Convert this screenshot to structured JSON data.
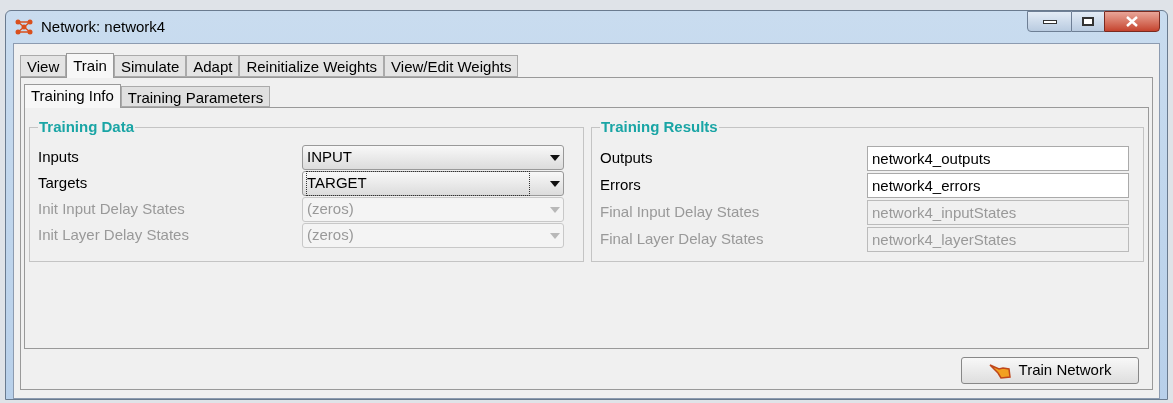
{
  "window": {
    "title": "Network: network4"
  },
  "tabs": [
    {
      "label": "View",
      "selected": false
    },
    {
      "label": "Train",
      "selected": true
    },
    {
      "label": "Simulate",
      "selected": false
    },
    {
      "label": "Adapt",
      "selected": false
    },
    {
      "label": "Reinitialize Weights",
      "selected": false
    },
    {
      "label": "View/Edit Weights",
      "selected": false
    }
  ],
  "subtabs": [
    {
      "label": "Training Info",
      "selected": true
    },
    {
      "label": "Training Parameters",
      "selected": false
    }
  ],
  "training_data": {
    "title": "Training Data",
    "rows": [
      {
        "label": "Inputs",
        "value": "INPUT",
        "disabled": false,
        "focused": false
      },
      {
        "label": "Targets",
        "value": "TARGET",
        "disabled": false,
        "focused": true
      },
      {
        "label": "Init Input Delay States",
        "value": "(zeros)",
        "disabled": true,
        "focused": false
      },
      {
        "label": "Init Layer Delay States",
        "value": "(zeros)",
        "disabled": true,
        "focused": false
      }
    ]
  },
  "training_results": {
    "title": "Training Results",
    "rows": [
      {
        "label": "Outputs",
        "value": "network4_outputs",
        "disabled": false
      },
      {
        "label": "Errors",
        "value": "network4_errors",
        "disabled": false
      },
      {
        "label": "Final Input Delay States",
        "value": "network4_inputStates",
        "disabled": true
      },
      {
        "label": "Final Layer Delay States",
        "value": "network4_layerStates",
        "disabled": true
      }
    ]
  },
  "train_button": {
    "label": "Train Network"
  }
}
